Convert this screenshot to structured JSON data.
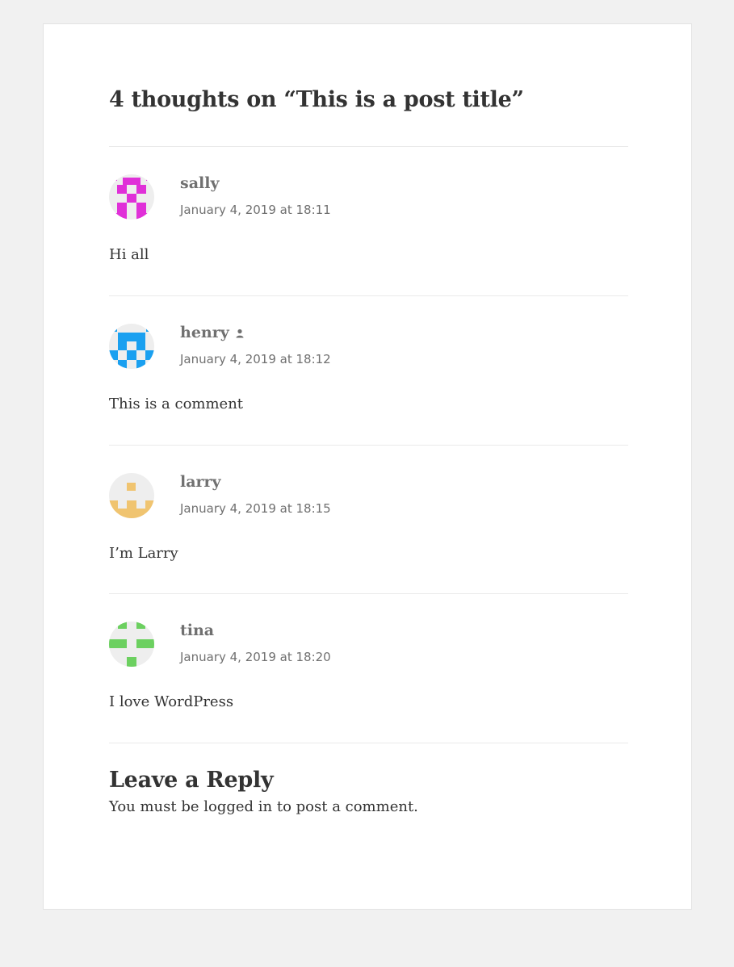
{
  "comments_title": "4 thoughts on “This is a post title”",
  "comments": [
    {
      "author": "sally",
      "date": "January 4, 2019 at 18:11",
      "text": "Hi all",
      "avatar_color": "#e030d8",
      "is_post_author": false
    },
    {
      "author": "henry",
      "date": "January 4, 2019 at 18:12",
      "text": "This is a comment",
      "avatar_color": "#1aa0f0",
      "is_post_author": true,
      "badge_icon": "person-icon"
    },
    {
      "author": "larry",
      "date": "January 4, 2019 at 18:15",
      "text": "I’m Larry",
      "avatar_color": "#f0c470",
      "is_post_author": false
    },
    {
      "author": "tina",
      "date": "January 4, 2019 at 18:20",
      "text": "I love WordPress",
      "avatar_color": "#6cd060",
      "is_post_author": false
    }
  ],
  "reply": {
    "title": "Leave a Reply",
    "prefix": "You must be ",
    "login_link": "logged in",
    "suffix": " to post a comment."
  }
}
